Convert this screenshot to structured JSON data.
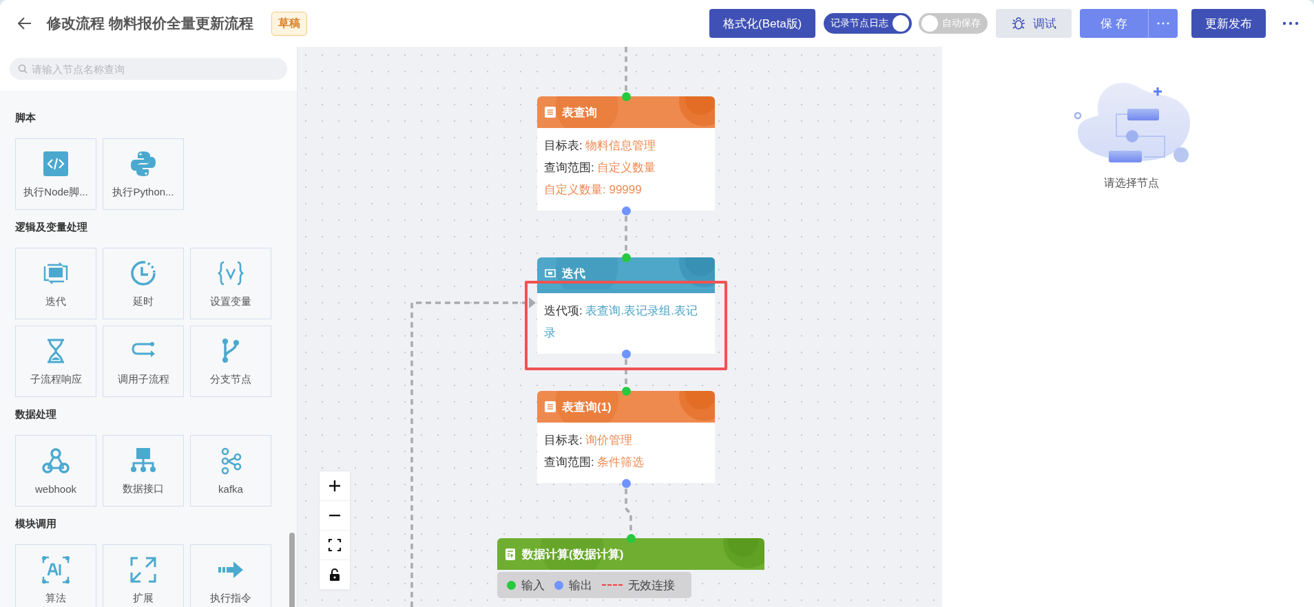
{
  "header": {
    "title": "修改流程 物料报价全量更新流程",
    "badge": "草稿",
    "format_button": "格式化(Beta版)",
    "toggles": [
      {
        "label": "记录节点日志",
        "on": true
      },
      {
        "label": "自动保存",
        "on": false
      }
    ],
    "debug_button": "调试",
    "save_button": "保 存",
    "publish_button": "更新发布"
  },
  "sidebar": {
    "search": {
      "placeholder": "请输入节点名称查询"
    },
    "sections": [
      {
        "title": "脚本",
        "items": [
          "执行Node脚...",
          "执行Python..."
        ]
      },
      {
        "title": "逻辑及变量处理",
        "items": [
          "迭代",
          "延时",
          "设置变量",
          "子流程响应",
          "调用子流程",
          "分支节点"
        ]
      },
      {
        "title": "数据处理",
        "items": [
          "webhook",
          "数据接口",
          "kafka"
        ]
      },
      {
        "title": "模块调用",
        "items": [
          "算法",
          "扩展",
          "执行指令"
        ]
      }
    ]
  },
  "canvas": {
    "nodes": [
      {
        "kind": "query",
        "title": "表查询",
        "selected": false,
        "fields": [
          {
            "label": "目标表:",
            "value": "物料信息管理"
          },
          {
            "label": "查询范围:",
            "value": "自定义数量"
          },
          {
            "value": "自定义数量: 99999"
          }
        ]
      },
      {
        "kind": "iterate",
        "title": "迭代",
        "selected": true,
        "fields": [
          {
            "label": "迭代项:",
            "value": "表查询.表记录组.表记录"
          }
        ]
      },
      {
        "kind": "query",
        "title": "表查询(1)",
        "selected": false,
        "fields": [
          {
            "label": "目标表:",
            "value": "询价管理"
          },
          {
            "label": "查询范围:",
            "value": "条件筛选"
          }
        ]
      },
      {
        "kind": "calc",
        "title": "数据计算(数据计算)",
        "selected": false
      }
    ],
    "legend": [
      {
        "kind": "input",
        "label": "输入"
      },
      {
        "kind": "output",
        "label": "输出"
      },
      {
        "kind": "invalid",
        "label": "无效连接"
      }
    ]
  },
  "detail": {
    "empty_text": "请选择节点"
  }
}
